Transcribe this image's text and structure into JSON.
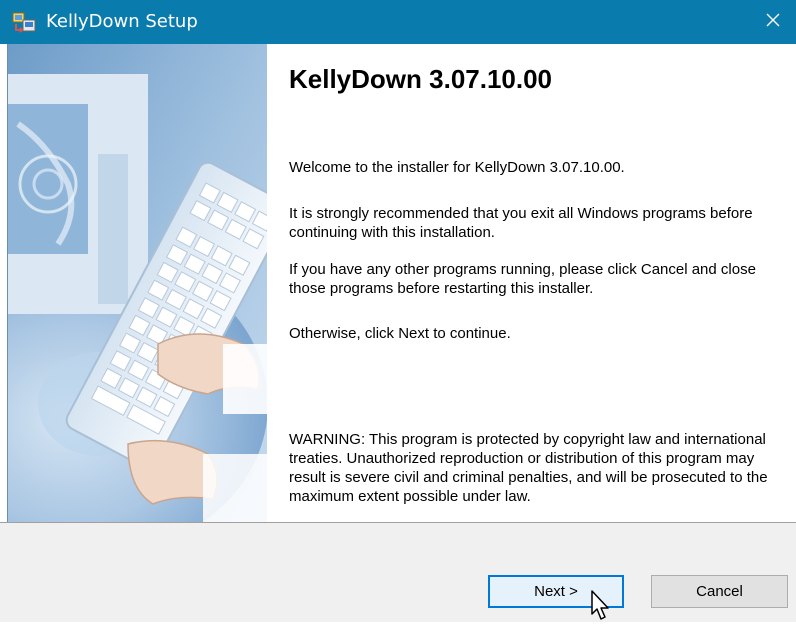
{
  "window": {
    "title": "KellyDown Setup",
    "title_bar_color": "#0a7bad",
    "icon": "setup-installer-icon",
    "close_icon": "close-icon"
  },
  "side_image": {
    "description_icon": "computer-keyboard-hands-illustration"
  },
  "content": {
    "heading": "KellyDown 3.07.10.00",
    "paragraphs": {
      "welcome": "Welcome to the installer for KellyDown 3.07.10.00.",
      "recommend": "It is strongly recommended that you exit all Windows programs before continuing with this installation.",
      "running": "If you have any other programs running, please click Cancel and close those programs before restarting this installer.",
      "otherwise": "Otherwise, click Next to continue.",
      "warning": "WARNING: This program is protected by copyright law and international treaties. Unauthorized reproduction or distribution of this program may result is severe civil and criminal penalties, and will be prosecuted to the maximum extent possible under law."
    }
  },
  "buttons": {
    "next": "Next >",
    "cancel": "Cancel"
  },
  "colors": {
    "accent": "#0078d7",
    "bottom_bar": "#f0f0f0"
  }
}
